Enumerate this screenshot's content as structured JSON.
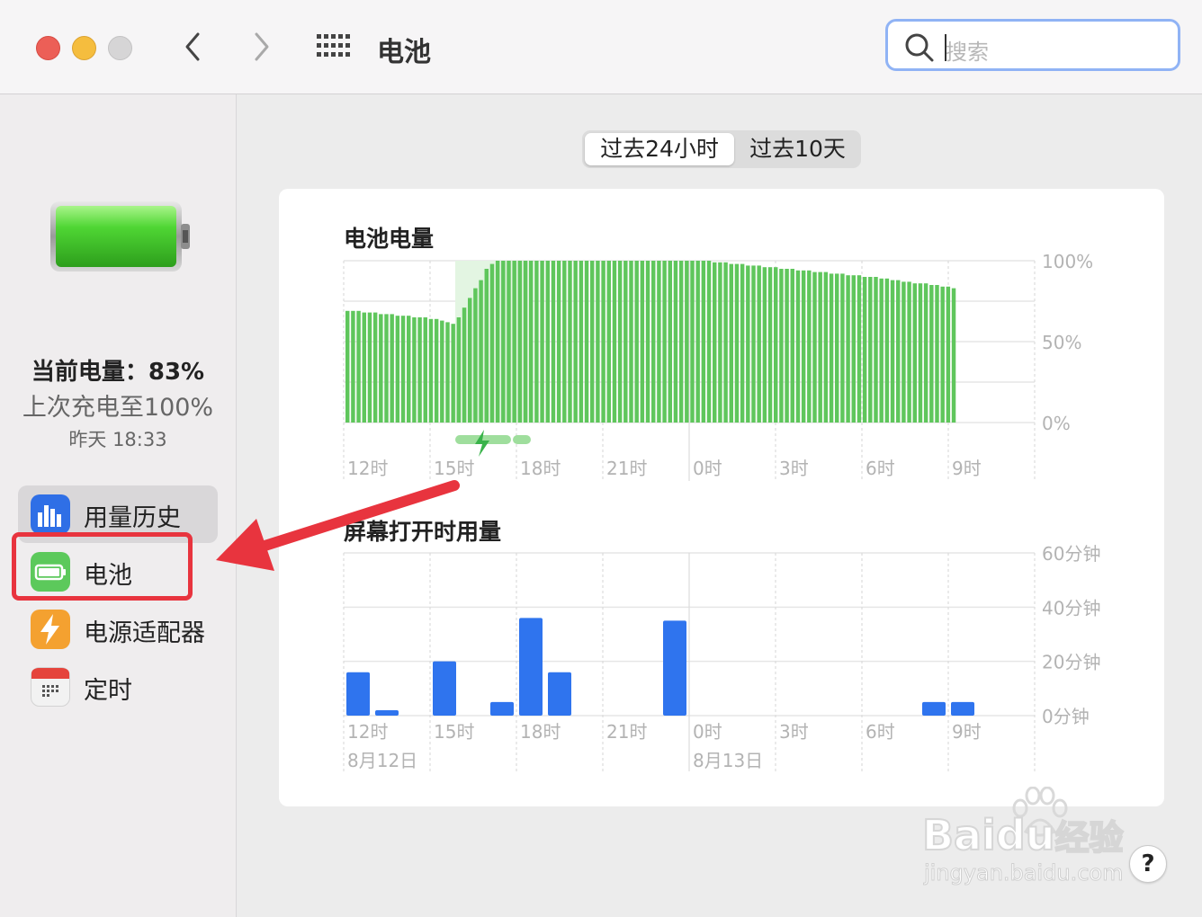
{
  "window": {
    "title": "电池",
    "search_placeholder": "搜索"
  },
  "sidebar": {
    "battery_icon": "battery-full-icon",
    "current_level_label": "当前电量：83%",
    "last_charged": "上次充电至100%",
    "last_charged_time": "昨天 18:33",
    "items": [
      {
        "label": "用量历史",
        "icon": "bar-chart-icon",
        "selected": true,
        "color": "#2f6fe6"
      },
      {
        "label": "电池",
        "icon": "battery-icon",
        "selected": false,
        "color": "#5cc95b"
      },
      {
        "label": "电源适配器",
        "icon": "lightning-icon",
        "selected": false,
        "color": "#f4a130"
      },
      {
        "label": "定时",
        "icon": "calendar-icon",
        "selected": false,
        "color": "#e5443c"
      }
    ]
  },
  "segmented": {
    "options": [
      "过去24小时",
      "过去10天"
    ],
    "selected": 0
  },
  "chart_data": [
    {
      "type": "bar",
      "title": "电池电量",
      "y_ticks": [
        "100%",
        "50%",
        "0%"
      ],
      "ylim": [
        0,
        100
      ],
      "x_ticks": [
        "12时",
        "15时",
        "18时",
        "21时",
        "0时",
        "3时",
        "6时",
        "9时"
      ],
      "color": "#5fc65c",
      "charging_color": "#8bd98a",
      "values": [
        69,
        69,
        69,
        68,
        68,
        68,
        67,
        67,
        67,
        66,
        66,
        66,
        65,
        65,
        65,
        64,
        64,
        63,
        62,
        61,
        65,
        71,
        77,
        83,
        88,
        95,
        98,
        100,
        100,
        100,
        100,
        100,
        100,
        100,
        100,
        100,
        100,
        100,
        100,
        100,
        100,
        100,
        100,
        100,
        100,
        100,
        100,
        100,
        100,
        100,
        100,
        100,
        100,
        100,
        100,
        100,
        100,
        100,
        100,
        100,
        100,
        100,
        100,
        100,
        100,
        100,
        99,
        99,
        99,
        98,
        98,
        98,
        97,
        97,
        97,
        96,
        96,
        96,
        95,
        95,
        95,
        94,
        94,
        94,
        93,
        93,
        93,
        92,
        92,
        92,
        91,
        91,
        91,
        90,
        90,
        90,
        89,
        89,
        88,
        88,
        87,
        87,
        86,
        86,
        86,
        85,
        85,
        84,
        84,
        83
      ],
      "charging_ranges": [
        [
          20,
          34
        ]
      ]
    },
    {
      "type": "bar",
      "title": "屏幕打开时用量",
      "y_ticks": [
        "60分钟",
        "40分钟",
        "20分钟",
        "0分钟"
      ],
      "ylim": [
        0,
        60
      ],
      "x_ticks": [
        "12时",
        "15时",
        "18时",
        "21时",
        "0时",
        "3时",
        "6时",
        "9时"
      ],
      "date_labels": [
        "8月12日",
        "8月13日"
      ],
      "color": "#2f74ee",
      "values": [
        16,
        2,
        0,
        20,
        0,
        5,
        36,
        16,
        0,
        0,
        0,
        35,
        0,
        0,
        0,
        0,
        0,
        0,
        0,
        0,
        5,
        5,
        0,
        0
      ]
    }
  ],
  "watermark": {
    "brand": "Baidu",
    "brand_suffix": "经验",
    "url": "jingyan.baidu.com"
  },
  "help_button": "?"
}
